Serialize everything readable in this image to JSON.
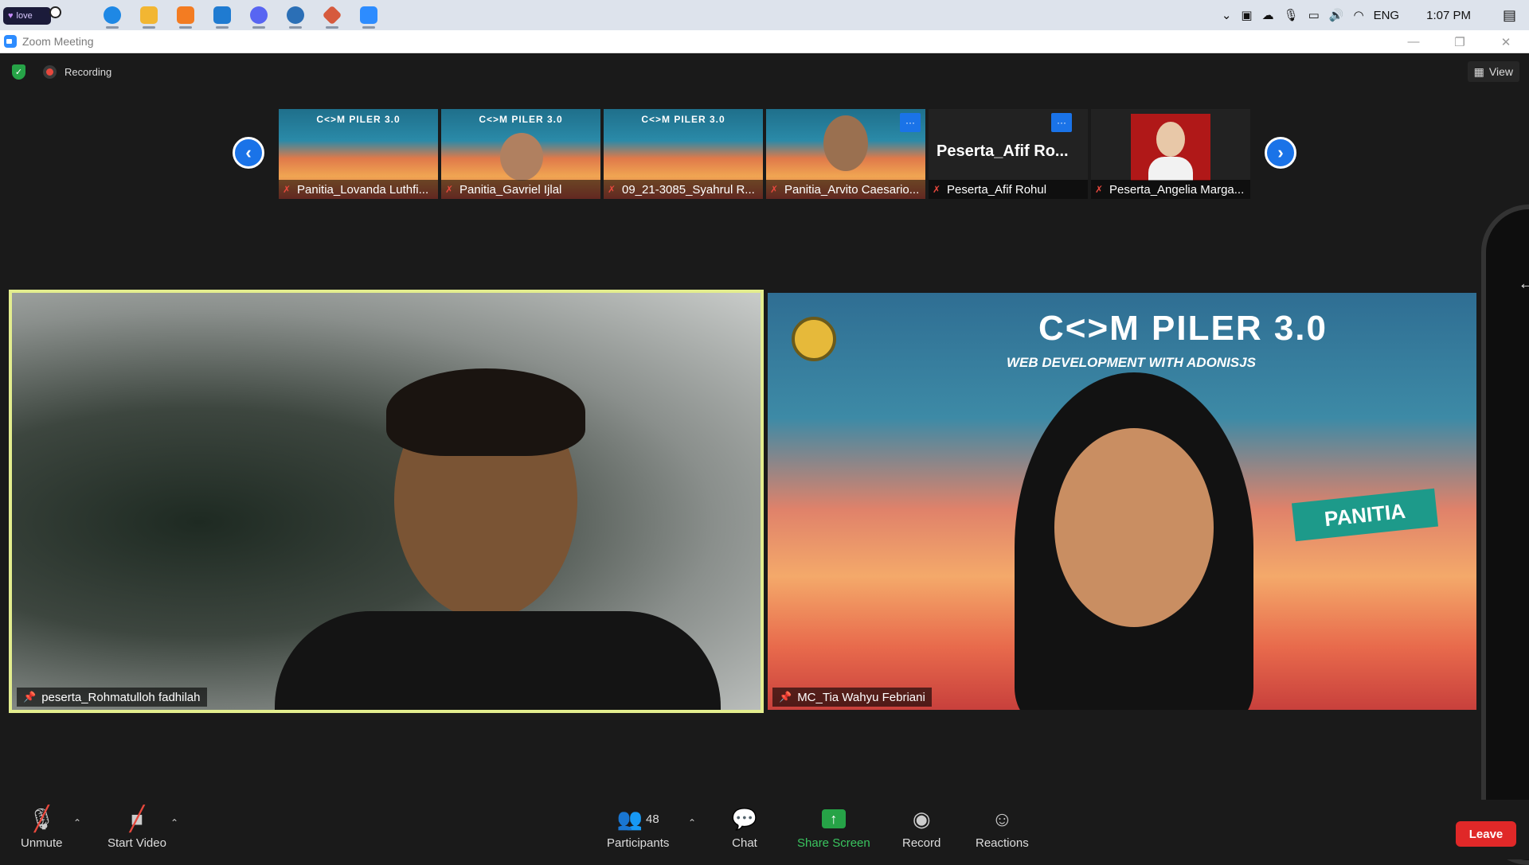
{
  "taskbar": {
    "love_label": "love",
    "lang": "ENG",
    "time": "1:07 PM",
    "apps": [
      {
        "name": "edge-icon",
        "color": "#1e88e5"
      },
      {
        "name": "file-explorer-icon",
        "color": "#f2b632"
      },
      {
        "name": "xampp-icon",
        "color": "#f37c22"
      },
      {
        "name": "vscode-icon",
        "color": "#1f7bd1"
      },
      {
        "name": "discord-icon",
        "color": "#5865f2"
      },
      {
        "name": "sourcetree-icon",
        "color": "#2b6fb6"
      },
      {
        "name": "git-icon",
        "color": "#d65a3d"
      },
      {
        "name": "zoom-icon",
        "color": "#2d8cff"
      }
    ]
  },
  "window": {
    "title": "Zoom Meeting"
  },
  "meeting": {
    "recording_label": "Recording",
    "view_label": "View",
    "event_logo": "C<>M PILER 3.0",
    "event_subtitle": "WEB DEVELOPMENT WITH ADONISJS",
    "badge_panitia": "PANITIA",
    "thumbnails": [
      {
        "name": "Panitia_Lovanda Luthfi..."
      },
      {
        "name": "Panitia_Gavriel Ijlal"
      },
      {
        "name": "09_21-3085_Syahrul R..."
      },
      {
        "name": "Panitia_Arvito Caesario..."
      },
      {
        "name": "Peserta_Afif Rohul",
        "title": "Peserta_Afif  Ro..."
      },
      {
        "name": "Peserta_Angelia Marga..."
      }
    ],
    "main_videos": [
      {
        "name": "peserta_Rohmatulloh fadhilah"
      },
      {
        "name": "MC_Tia Wahyu Febriani"
      }
    ]
  },
  "toolbar": {
    "unmute": "Unmute",
    "start_video": "Start Video",
    "participants": "Participants",
    "participants_count": "48",
    "chat": "Chat",
    "share_screen": "Share Screen",
    "record": "Record",
    "reactions": "Reactions",
    "leave": "Leave"
  }
}
